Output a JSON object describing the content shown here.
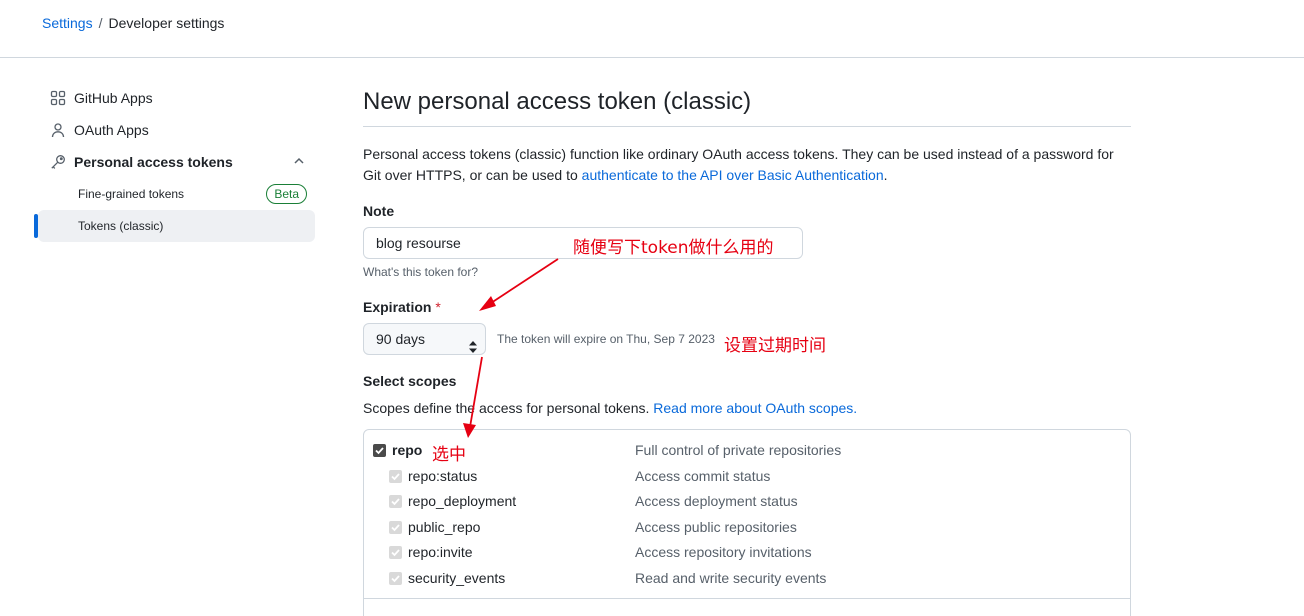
{
  "breadcrumb": {
    "root": "Settings",
    "separator": "/",
    "current": "Developer settings"
  },
  "sidebar": {
    "items": [
      {
        "label": "GitHub Apps",
        "icon": "apps-icon"
      },
      {
        "label": "OAuth Apps",
        "icon": "person-icon"
      },
      {
        "label": "Personal access tokens",
        "icon": "key-icon",
        "expanded": true
      }
    ],
    "sub_items": [
      {
        "label": "Fine-grained tokens",
        "badge": "Beta"
      },
      {
        "label": "Tokens (classic)",
        "active": true
      }
    ]
  },
  "main": {
    "title": "New personal access token (classic)",
    "intro_text": "Personal access tokens (classic) function like ordinary OAuth access tokens. They can be used instead of a password for Git over HTTPS, or can be used to ",
    "intro_link": "authenticate to the API over Basic Authentication",
    "intro_end": ".",
    "note": {
      "label": "Note",
      "value": "blog resourse",
      "hint": "What's this token for?"
    },
    "expiration": {
      "label": "Expiration",
      "required_mark": "*",
      "selected": "90 days",
      "expire_text": "The token will expire on Thu, Sep 7 2023"
    },
    "scopes": {
      "label": "Select scopes",
      "description": "Scopes define the access for personal tokens. ",
      "description_link": "Read more about OAuth scopes.",
      "items": [
        {
          "name": "repo",
          "description": "Full control of private repositories",
          "checked": true,
          "parent": true
        },
        {
          "name": "repo:status",
          "description": "Access commit status",
          "checked": true
        },
        {
          "name": "repo_deployment",
          "description": "Access deployment status",
          "checked": true
        },
        {
          "name": "public_repo",
          "description": "Access public repositories",
          "checked": true
        },
        {
          "name": "repo:invite",
          "description": "Access repository invitations",
          "checked": true
        },
        {
          "name": "security_events",
          "description": "Read and write security events",
          "checked": true
        }
      ]
    }
  },
  "annotations": {
    "note_hint": "随便写下token做什么用的",
    "expiration_hint": "设置过期时间",
    "select_hint": "选中",
    "color": "#e60012"
  },
  "colors": {
    "link": "#0969da",
    "active_bar": "#0969da",
    "beta": "#1a7f37",
    "border": "#d0d7de"
  }
}
